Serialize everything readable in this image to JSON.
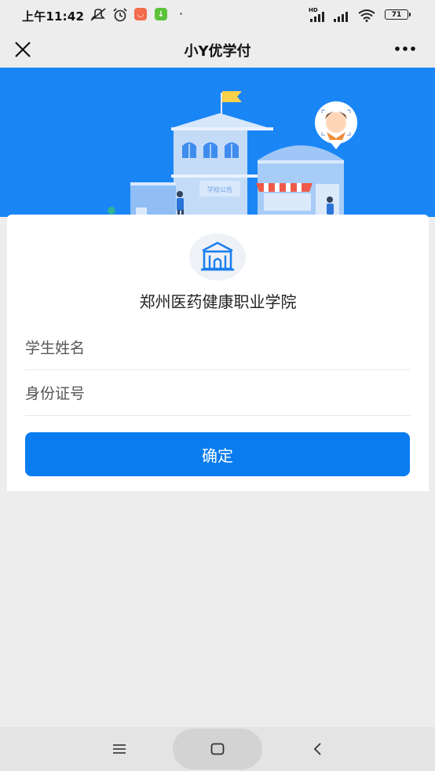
{
  "status_bar": {
    "time": "上午11:42",
    "network": "HD",
    "battery": "71"
  },
  "nav": {
    "title": "小Y优学付"
  },
  "card": {
    "school_name": "郑州医药健康职业学院",
    "fields": {
      "student_name_placeholder": "学生姓名",
      "id_number_placeholder": "身份证号"
    },
    "confirm_label": "确定"
  },
  "banner": {
    "sign_text": "学校公告"
  },
  "colors": {
    "banner": "#1a86f5",
    "accent": "#0a7cf0"
  },
  "icons": [
    "close-icon",
    "more-icon",
    "school-building-icon",
    "home-nav-icon",
    "back-nav-icon",
    "menu-nav-icon"
  ]
}
